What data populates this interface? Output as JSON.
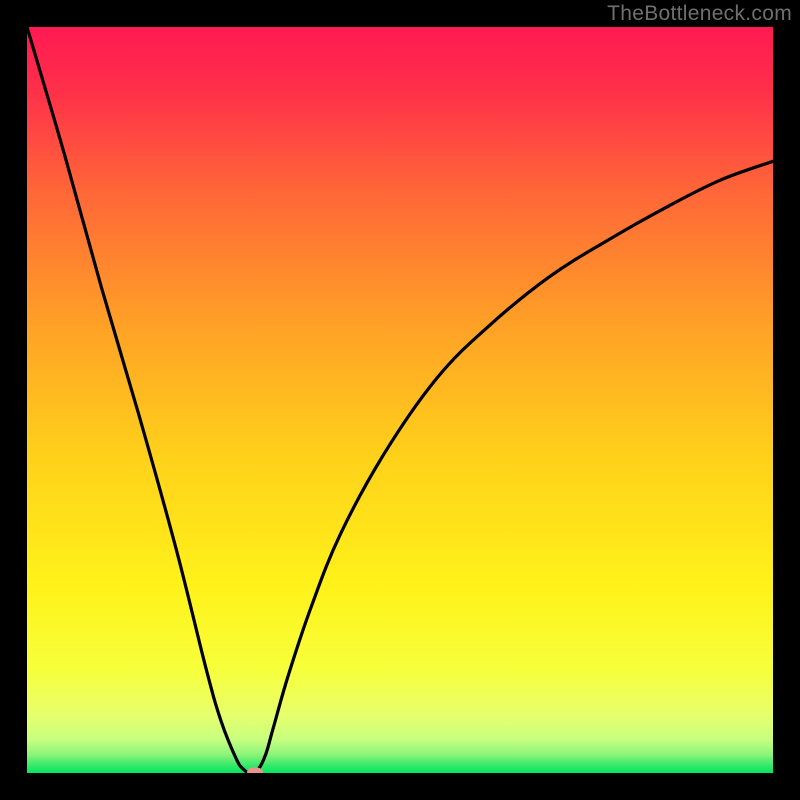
{
  "watermark": "TheBottleneck.com",
  "chart_data": {
    "type": "line",
    "title": "",
    "xlabel": "",
    "ylabel": "",
    "xlim": [
      0,
      100
    ],
    "ylim": [
      0,
      100
    ],
    "x": [
      0,
      5,
      10,
      15,
      20,
      24,
      26,
      28,
      29,
      30,
      31,
      32,
      33,
      35,
      38,
      42,
      48,
      55,
      62,
      70,
      78,
      86,
      93,
      100
    ],
    "values": [
      100,
      83,
      65,
      48,
      30,
      14,
      7,
      2,
      0.5,
      0,
      0.5,
      2.5,
      6,
      13,
      22,
      32,
      43,
      53,
      60,
      66.5,
      71.5,
      76,
      79.5,
      82
    ],
    "grid": false,
    "legend": false,
    "background_gradient": {
      "top": "#FF1A52",
      "middle": "#FFD400",
      "bottom": "#00E85C"
    },
    "marker": {
      "x": 30.5,
      "y": 0,
      "color": "#E9948D"
    }
  }
}
